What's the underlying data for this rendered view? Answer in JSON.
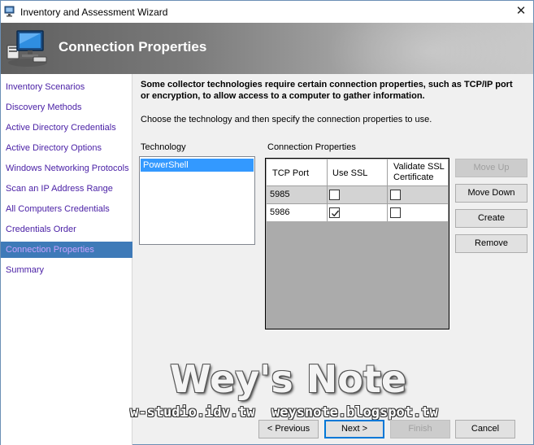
{
  "window": {
    "title": "Inventory and Assessment Wizard",
    "close_glyph": "✕"
  },
  "banner": {
    "heading": "Connection Properties",
    "icon": "computer-network-icon"
  },
  "nav": {
    "items": [
      {
        "label": "Inventory Scenarios",
        "active": false
      },
      {
        "label": "Discovery Methods",
        "active": false
      },
      {
        "label": "Active Directory Credentials",
        "active": false
      },
      {
        "label": "Active Directory Options",
        "active": false
      },
      {
        "label": "Windows Networking Protocols",
        "active": false
      },
      {
        "label": "Scan an IP Address Range",
        "active": false
      },
      {
        "label": "All Computers Credentials",
        "active": false
      },
      {
        "label": "Credentials Order",
        "active": false
      },
      {
        "label": "Connection Properties",
        "active": true
      },
      {
        "label": "Summary",
        "active": false
      }
    ]
  },
  "main": {
    "intro": "Some collector technologies require certain connection properties, such as TCP/IP port or encryption, to allow access to a computer to gather information.",
    "instruction": "Choose the technology and then specify the connection properties to use.",
    "technology_label": "Technology",
    "technology_items": [
      "PowerShell"
    ],
    "props_label": "Connection Properties",
    "grid": {
      "columns": [
        "TCP Port",
        "Use SSL",
        "Validate SSL Certificate"
      ],
      "rows": [
        {
          "port": "5985",
          "use_ssl": false,
          "validate_ssl": false
        },
        {
          "port": "5986",
          "use_ssl": true,
          "validate_ssl": false
        }
      ]
    },
    "buttons": {
      "move_up": "Move Up",
      "move_down": "Move Down",
      "create": "Create",
      "remove": "Remove"
    }
  },
  "footer": {
    "previous": "< Previous",
    "next": "Next >",
    "finish": "Finish",
    "cancel": "Cancel"
  },
  "watermark": {
    "title": "Wey's Note",
    "sites": "w-studio.idv.tw  weysnote.blogspot.tw"
  },
  "colors": {
    "nav_active_bg": "#3e7ab8",
    "nav_link": "#4b21a6",
    "selection": "#3399ff",
    "default_button_border": "#0078d7"
  }
}
